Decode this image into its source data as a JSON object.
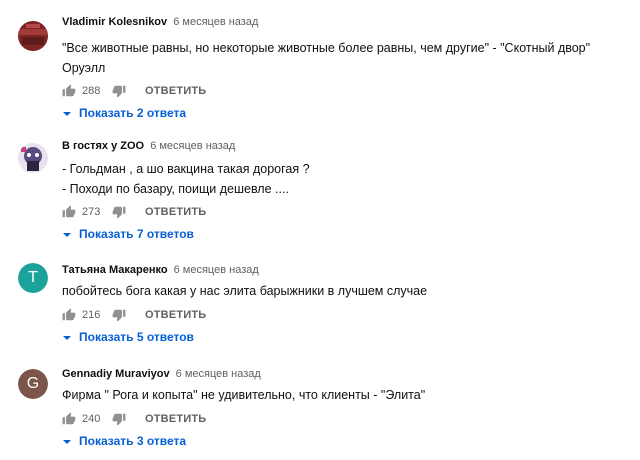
{
  "comments": [
    {
      "author": "Vladimir Kolesnikov",
      "date": "6 месяцев назад",
      "lines": [
        "\"Все животные равны, но некоторые животные более равны, чем другие\" - \"Скотный двор\"",
        "Оруэлл"
      ],
      "likes": "288",
      "reply_label": "ОТВЕТИТЬ",
      "show_replies": "Показать 2 ответа",
      "avatar": {
        "type": "image",
        "color": "#8b2a2a"
      }
    },
    {
      "author": "В гостях у ZOO",
      "date": "6 месяцев назад",
      "lines": [
        "- Гольдман , а шо вакцина такая дорогая ?",
        "- Походи по базару, поищи дешевле ...."
      ],
      "likes": "273",
      "reply_label": "ОТВЕТИТЬ",
      "show_replies": "Показать 7 ответов",
      "avatar": {
        "type": "image",
        "color": "#6a5a8c"
      }
    },
    {
      "author": "Татьяна Макаренко",
      "date": "6 месяцев назад",
      "lines": [
        "побойтесь бога какая у нас элита  барыжники в лучшем случае"
      ],
      "likes": "216",
      "reply_label": "ОТВЕТИТЬ",
      "show_replies": "Показать 5 ответов",
      "avatar": {
        "type": "letter",
        "letter": "T",
        "color": "#1aa39a"
      }
    },
    {
      "author": "Gennadiy Muraviyov",
      "date": "6 месяцев назад",
      "lines": [
        "Фирма \" Рога и копыта\" не удивительно, что клиенты - \"Элита\""
      ],
      "likes": "240",
      "reply_label": "ОТВЕТИТЬ",
      "show_replies": "Показать 3 ответа",
      "avatar": {
        "type": "letter",
        "letter": "G",
        "color": "#7a5548"
      }
    }
  ],
  "colors": {
    "link": "#065fd4",
    "meta": "#606060",
    "text": "#0f0f0f"
  },
  "icons": {
    "like": "thumb-up-icon",
    "dislike": "thumb-down-icon",
    "expand": "chevron-down-icon"
  }
}
